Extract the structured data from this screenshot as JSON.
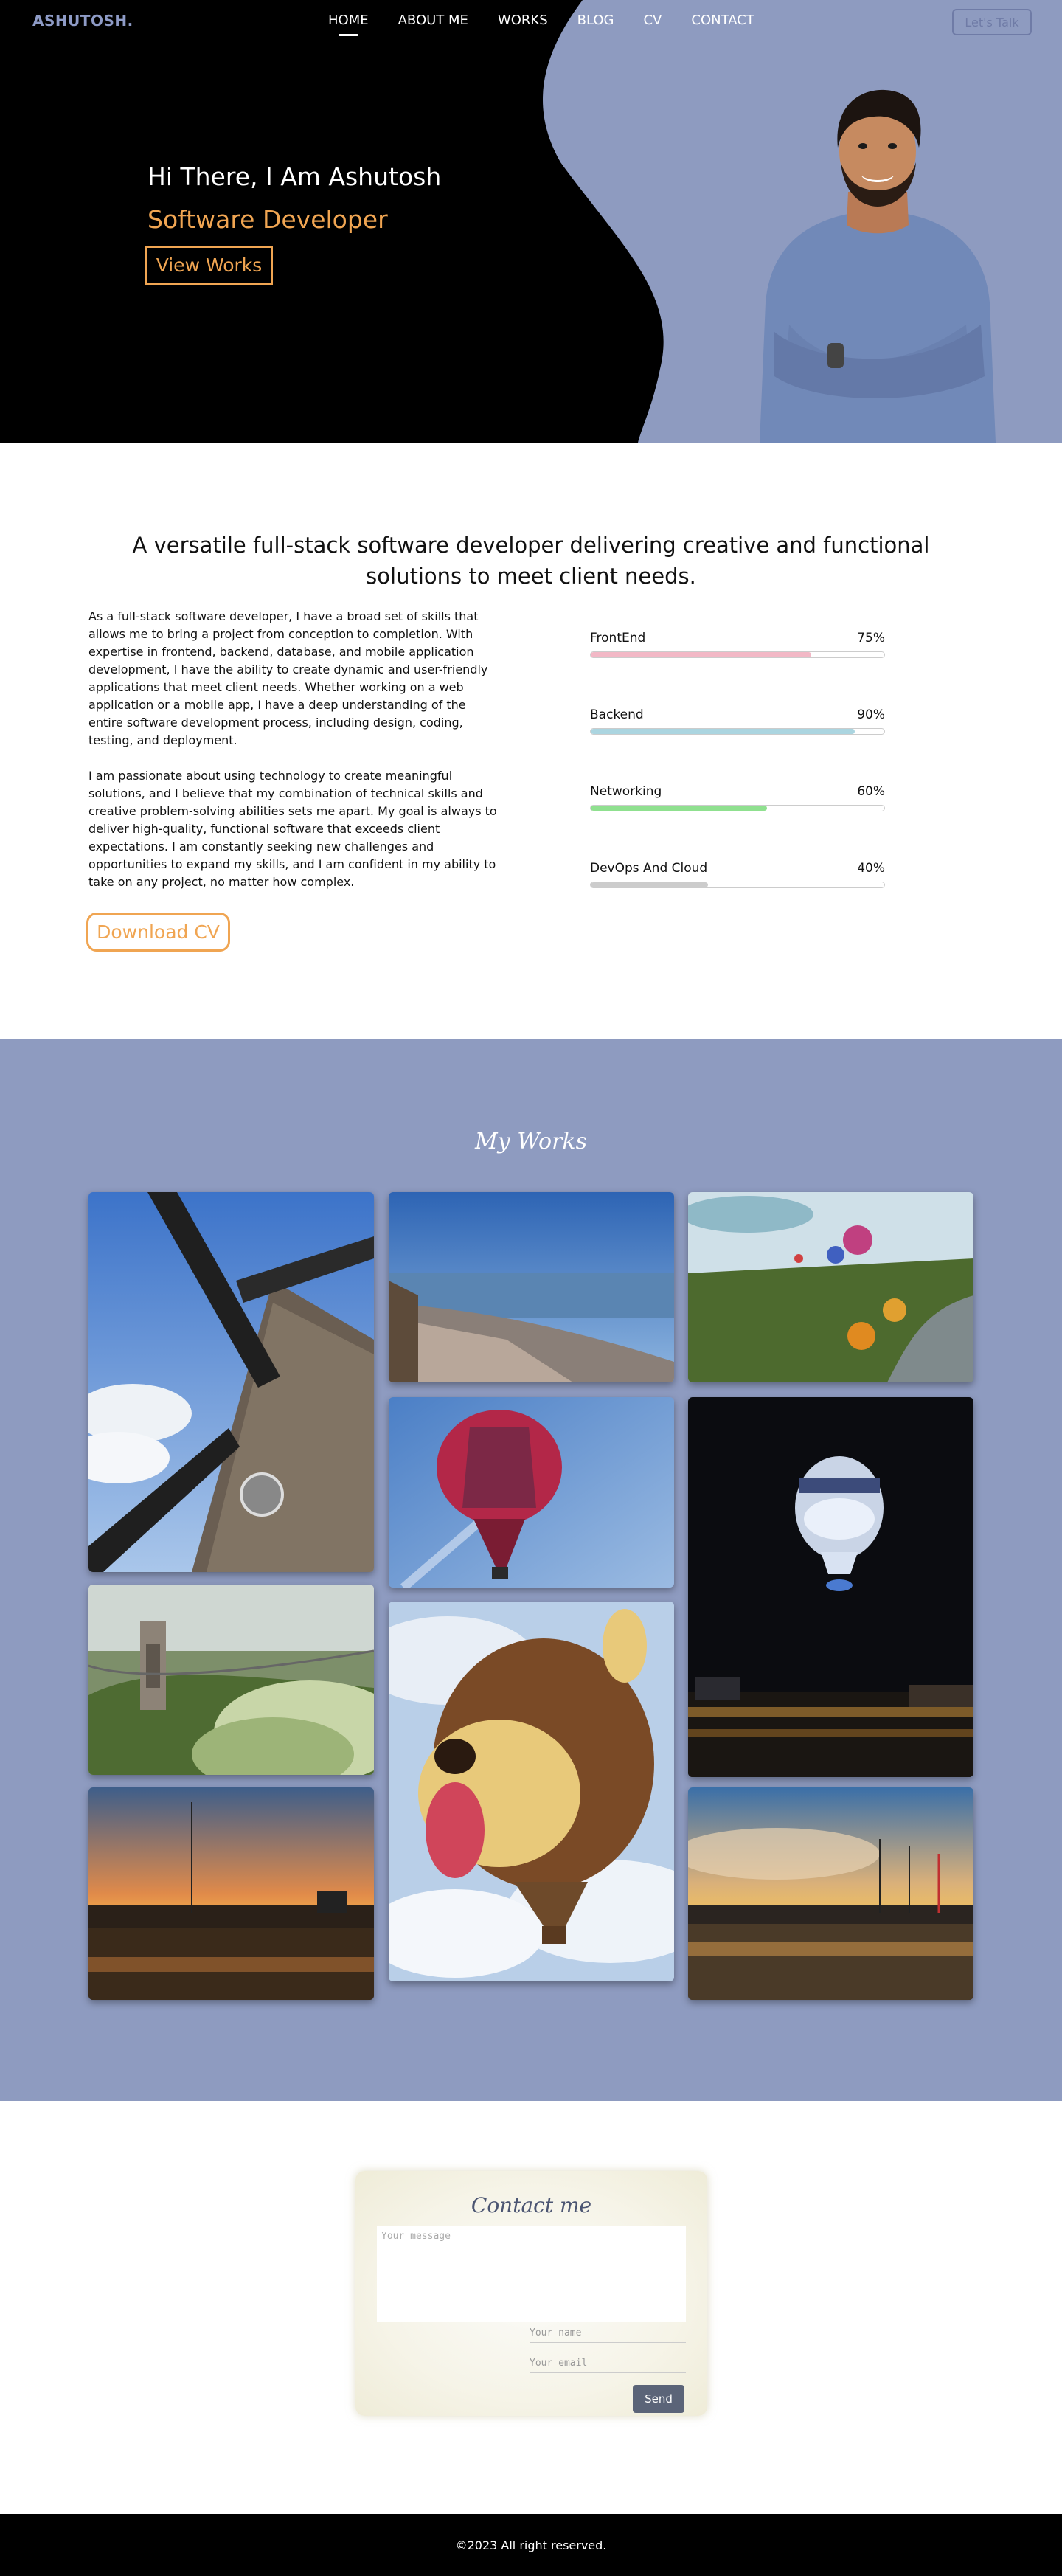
{
  "nav": {
    "logo": "ASHUTOSH.",
    "links": [
      "HOME",
      "ABOUT ME",
      "WORKS",
      "BLOG",
      "CV",
      "CONTACT"
    ],
    "cta": "Let's Talk"
  },
  "hero": {
    "greeting": "Hi There, I Am Ashutosh",
    "role": "Software Developer",
    "button": "View Works"
  },
  "about": {
    "title": "A versatile full-stack software developer delivering creative and functional solutions to meet client needs.",
    "paragraphs": [
      "As a full-stack software developer, I have a broad set of skills that allows me to bring a project from conception to completion. With expertise in frontend, backend, database, and mobile application development, I have the ability to create dynamic and user-friendly applications that meet client needs. Whether working on a web application or a mobile app, I have a deep understanding of the entire software development process, including design, coding, testing, and deployment.",
      "I am passionate about using technology to create meaningful solutions, and I believe that my combination of technical skills and creative problem-solving abilities sets me apart. My goal is always to deliver high-quality, functional software that exceeds client expectations. I am constantly seeking new challenges and opportunities to expand my skills, and I am confident in my ability to take on any project, no matter how complex."
    ],
    "download_button": "Download CV",
    "skills": [
      {
        "name": "FrontEnd",
        "percent_label": "75%",
        "value": 0.75,
        "color": "#f2b8c6"
      },
      {
        "name": "Backend",
        "percent_label": "90%",
        "value": 0.9,
        "color": "#abd5e0"
      },
      {
        "name": "Networking",
        "percent_label": "60%",
        "value": 0.6,
        "color": "#8fe08f"
      },
      {
        "name": "DevOps And Cloud",
        "percent_label": "40%",
        "value": 0.4,
        "color": "#cccccc"
      }
    ]
  },
  "works": {
    "title": "My Works"
  },
  "contact": {
    "title": "Contact me",
    "message_placeholder": "Your message",
    "name_placeholder": "Your name",
    "email_placeholder": "Your email",
    "send": "Send"
  },
  "footer": {
    "text": "©2023 All right reserved."
  },
  "colors": {
    "accent": "#f0a552",
    "brand": "#8e9bc0"
  }
}
